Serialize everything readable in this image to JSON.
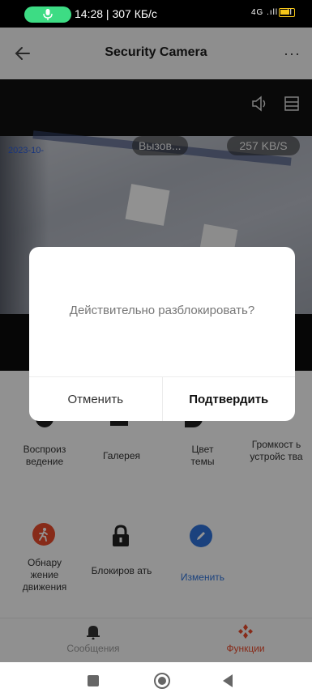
{
  "status_bar": {
    "time_speed": "14:28 | 307 КБ/с",
    "network": "4G .ıll .ıll"
  },
  "header": {
    "title": "Security Camera",
    "more": "···"
  },
  "video": {
    "timestamp": "2023-10-",
    "calling": "Вызов...",
    "speed": "257 KB/S"
  },
  "functions": {
    "row1": [
      {
        "label": "Воспроиз ведение"
      },
      {
        "label": "Галерея"
      },
      {
        "label": "Цвет темы"
      },
      {
        "label": "Громкост ь устройс тва"
      }
    ],
    "row2": [
      {
        "label": "Обнару жение движения"
      },
      {
        "label": "Блокиров ать"
      },
      {
        "label": "Изменить"
      }
    ]
  },
  "tabbar": {
    "messages": "Сообщения",
    "functions": "Функции"
  },
  "dialog": {
    "message": "Действительно разблокировать?",
    "cancel": "Отменить",
    "confirm": "Подтвердить"
  },
  "colors": {
    "accent_red": "#e84a2b",
    "accent_blue": "#2f73d9",
    "mic_green": "#3ddc84"
  }
}
